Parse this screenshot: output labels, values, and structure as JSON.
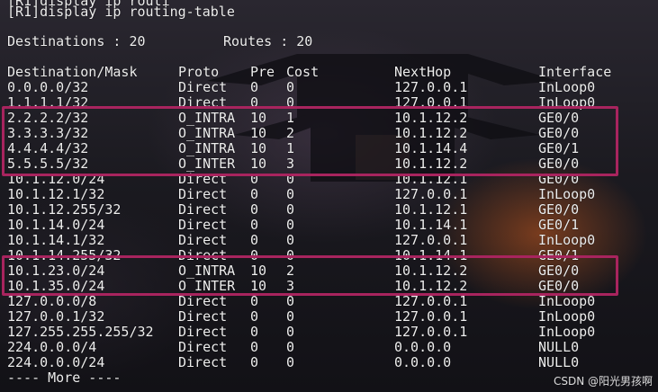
{
  "terminal": {
    "top_partial": "[R1]display ip routi",
    "command": "[R1]display ip routing-table",
    "destinations_label": "Destinations : 20",
    "routes_label": "Routes : 20",
    "headers": {
      "dest": "Destination/Mask",
      "proto": "Proto",
      "pre": "Pre",
      "cost": "Cost",
      "nexthop": "NextHop",
      "iface": "Interface"
    },
    "rows": [
      {
        "dest": "0.0.0.0/32",
        "proto": "Direct",
        "pre": "0",
        "cost": "0",
        "nexthop": "127.0.0.1",
        "iface": "InLoop0"
      },
      {
        "dest": "1.1.1.1/32",
        "proto": "Direct",
        "pre": "0",
        "cost": "0",
        "nexthop": "127.0.0.1",
        "iface": "InLoop0"
      },
      {
        "dest": "2.2.2.2/32",
        "proto": "O_INTRA",
        "pre": "10",
        "cost": "1",
        "nexthop": "10.1.12.2",
        "iface": "GE0/0"
      },
      {
        "dest": "3.3.3.3/32",
        "proto": "O_INTRA",
        "pre": "10",
        "cost": "2",
        "nexthop": "10.1.12.2",
        "iface": "GE0/0"
      },
      {
        "dest": "4.4.4.4/32",
        "proto": "O_INTRA",
        "pre": "10",
        "cost": "1",
        "nexthop": "10.1.14.4",
        "iface": "GE0/1"
      },
      {
        "dest": "5.5.5.5/32",
        "proto": "O_INTER",
        "pre": "10",
        "cost": "3",
        "nexthop": "10.1.12.2",
        "iface": "GE0/0"
      },
      {
        "dest": "10.1.12.0/24",
        "proto": "Direct",
        "pre": "0",
        "cost": "0",
        "nexthop": "10.1.12.1",
        "iface": "GE0/0"
      },
      {
        "dest": "10.1.12.1/32",
        "proto": "Direct",
        "pre": "0",
        "cost": "0",
        "nexthop": "127.0.0.1",
        "iface": "InLoop0"
      },
      {
        "dest": "10.1.12.255/32",
        "proto": "Direct",
        "pre": "0",
        "cost": "0",
        "nexthop": "10.1.12.1",
        "iface": "GE0/0"
      },
      {
        "dest": "10.1.14.0/24",
        "proto": "Direct",
        "pre": "0",
        "cost": "0",
        "nexthop": "10.1.14.1",
        "iface": "GE0/1"
      },
      {
        "dest": "10.1.14.1/32",
        "proto": "Direct",
        "pre": "0",
        "cost": "0",
        "nexthop": "127.0.0.1",
        "iface": "InLoop0"
      },
      {
        "dest": "10.1.14.255/32",
        "proto": "Direct",
        "pre": "0",
        "cost": "0",
        "nexthop": "10.1.14.1",
        "iface": "GE0/1"
      },
      {
        "dest": "10.1.23.0/24",
        "proto": "O_INTRA",
        "pre": "10",
        "cost": "2",
        "nexthop": "10.1.12.2",
        "iface": "GE0/0"
      },
      {
        "dest": "10.1.35.0/24",
        "proto": "O_INTER",
        "pre": "10",
        "cost": "3",
        "nexthop": "10.1.12.2",
        "iface": "GE0/0"
      },
      {
        "dest": "127.0.0.0/8",
        "proto": "Direct",
        "pre": "0",
        "cost": "0",
        "nexthop": "127.0.0.1",
        "iface": "InLoop0"
      },
      {
        "dest": "127.0.0.1/32",
        "proto": "Direct",
        "pre": "0",
        "cost": "0",
        "nexthop": "127.0.0.1",
        "iface": "InLoop0"
      },
      {
        "dest": "127.255.255.255/32",
        "proto": "Direct",
        "pre": "0",
        "cost": "0",
        "nexthop": "127.0.0.1",
        "iface": "InLoop0"
      },
      {
        "dest": "224.0.0.0/4",
        "proto": "Direct",
        "pre": "0",
        "cost": "0",
        "nexthop": "0.0.0.0",
        "iface": "NULL0"
      },
      {
        "dest": "224.0.0.0/24",
        "proto": "Direct",
        "pre": "0",
        "cost": "0",
        "nexthop": "0.0.0.0",
        "iface": "NULL0"
      }
    ],
    "more": "---- More ----",
    "highlight_color": "#a8245e"
  },
  "watermark": "CSDN @阳光男孩啊"
}
